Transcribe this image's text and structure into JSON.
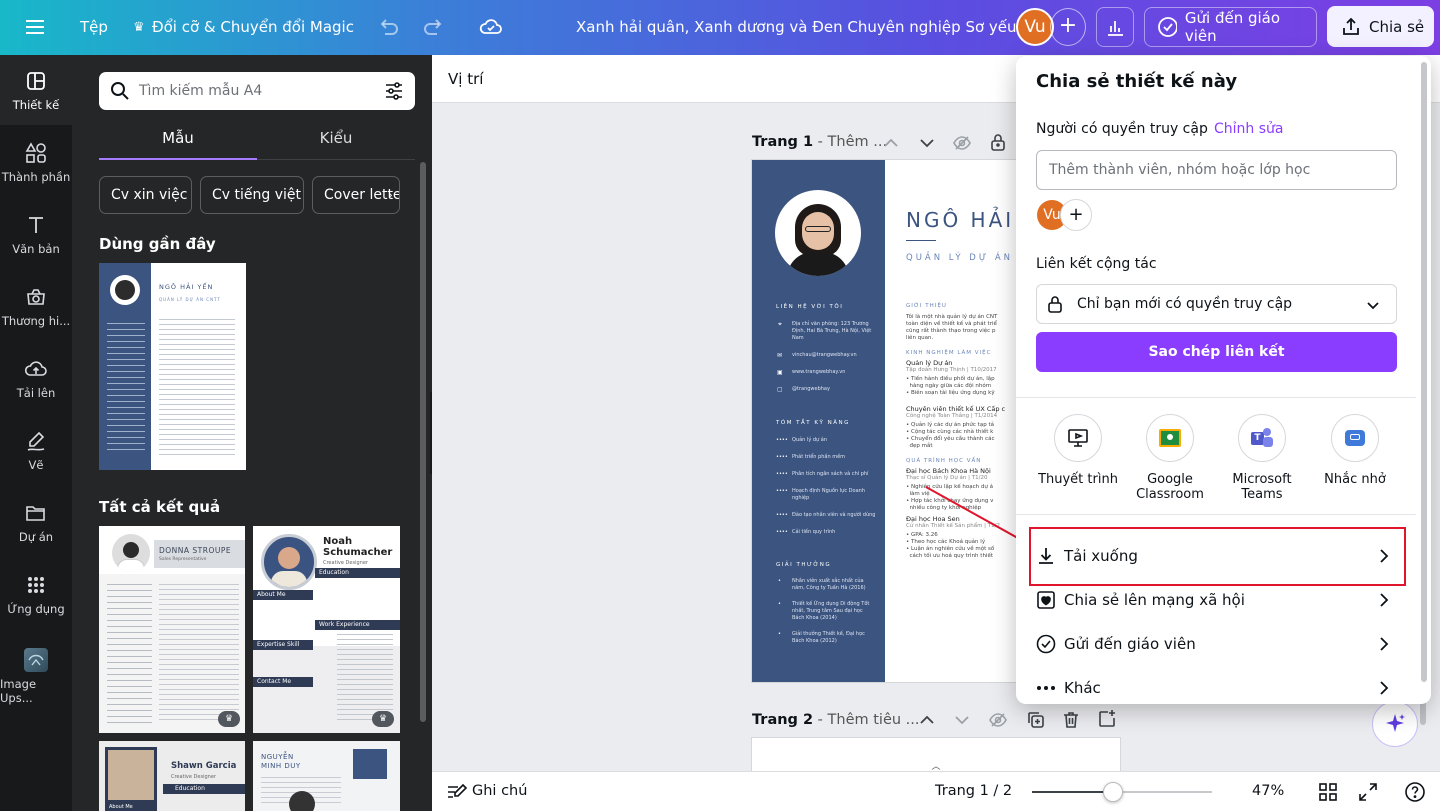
{
  "topbar": {
    "file": "Tệp",
    "magic": "Đổi cỡ & Chuyển đổi Magic",
    "doc_title": "Xanh hải quân, Xanh dương và Đen Chuyên nghiệp Sơ yếu ...",
    "avatar": "Vu",
    "send_teacher": "Gửi đến giáo viên",
    "share": "Chia sẻ"
  },
  "rail": [
    {
      "label": "Thiết kế",
      "icon": "layout-icon"
    },
    {
      "label": "Thành phần",
      "icon": "elements-icon"
    },
    {
      "label": "Văn bản",
      "icon": "text-icon"
    },
    {
      "label": "Thương hi...",
      "icon": "brand-icon"
    },
    {
      "label": "Tải lên",
      "icon": "upload-icon"
    },
    {
      "label": "Vẽ",
      "icon": "draw-icon"
    },
    {
      "label": "Dự án",
      "icon": "folder-icon"
    },
    {
      "label": "Ứng dụng",
      "icon": "apps-icon"
    },
    {
      "label": "Image Ups...",
      "icon": "image-upscaler-icon"
    }
  ],
  "panel": {
    "search_placeholder": "Tìm kiếm mẫu A4",
    "tabs": [
      "Mẫu",
      "Kiểu"
    ],
    "chips": [
      "Cv xin việc",
      "Cv tiếng việt",
      "Cover letter"
    ],
    "recent_title": "Dùng gần đây",
    "results_title": "Tất cả kết quả",
    "recent_name": "NGÔ HẢI YẾN",
    "recent_role": "QUẢN LÝ DỰ ÁN CNTT",
    "templates": [
      {
        "name": "DONNA STROUPE",
        "role": "Sales Representative"
      },
      {
        "name": "Noah Schumacher",
        "role": "Creative Designer"
      },
      {
        "name": "Shawn Garcia",
        "role": "Creative Designer"
      },
      {
        "name": "NGUYỄN MINH DUY",
        "role": ""
      }
    ],
    "tpl_labels": {
      "about": "About Me",
      "education": "Education",
      "work": "Work Experience",
      "expertise": "Expertise Skill",
      "contact": "Contact Me"
    }
  },
  "canvas": {
    "position_label": "Vị trí",
    "page1_label": "Trang 1",
    "page1_title": "Thêm ...",
    "page2_label": "Trang 2",
    "page2_title": "Thêm tiêu ..."
  },
  "resume": {
    "name": "NGÔ HẢI Y",
    "role": "QUẢN LÝ DỰ ÁN",
    "contact_title": "LIÊN HỆ VỚI TÔI",
    "contact_lines": [
      "Địa chỉ văn phòng: 123 Trương Định, Hai Bà Trưng, Hà Nội, Việt Nam",
      "vinchau@trangwebhay.vn",
      "www.trangwebhay.vn",
      "@trangwebhay"
    ],
    "skills_title": "TÓM TẮT KỸ NĂNG",
    "skills": [
      "Quản lý dự án",
      "Phát triển phần mềm",
      "Phân tích ngân sách và chi phí",
      "Hoạch định Nguồn lực Doanh nghiệp",
      "Đào tạo nhân viên và người dùng",
      "Cải tiến quy trình"
    ],
    "awards_title": "GIẢI THƯỞNG",
    "awards": [
      "Nhân viên xuất sắc nhất của năm, Công ty Tuấn Hà (2016)",
      "Thiết kế Ứng dụng Di động Tốt nhất, Trung tâm Sau đại học Bách Khoa (2014)",
      "Giải thưởng Thiết kế, Đại học Bách Khoa (2012)"
    ],
    "intro_title": "GIỚI THIỆU",
    "intro": [
      "Tôi là một nhà quản lý dự án CNT",
      "toàn diện về thiết kế và phát triể",
      "cũng rất thành thạo trong việc p",
      "liên quan."
    ],
    "exp_title": "KINH NGHIỆM LÀM VIỆC",
    "job1_title": "Quản lý Dự án",
    "job1_sub": "Tập đoàn Hưng Thịnh | T10/2017",
    "job1_lines": [
      "Tiến hành điều phối dự án, lập",
      "hàng ngày giữa các đội nhóm",
      "Biên soạn tài liệu ứng dụng kỹ"
    ],
    "job2_title": "Chuyên viên thiết kế UX Cấp c",
    "job2_sub": "Công nghệ Toàn Thắng | T1/2014",
    "job2_lines": [
      "Quản lý các dự án phức tạp tả",
      "Cộng tác cùng các nhà thiết k",
      "Chuyển đổi yêu cầu thành các",
      "đẹp mắt"
    ],
    "edu_title": "QUÁ TRÌNH HỌC VẤN",
    "edu1_title": "Đại học Bách Khoa Hà Nội",
    "edu1_sub": "Thạc sĩ Quản lý Dự án | T1/20",
    "edu1_lines": [
      "Nghiên cứu lập kế hoạch dự á",
      "làm việ",
      "Hợp tác khởi chạy ứng dụng v",
      "nhiều công ty khởi nghiệp"
    ],
    "edu2_title": "Đại học Hoa Sen",
    "edu2_sub": "Cử nhân Thiết kế Sản phẩm | T1/2",
    "edu2_lines": [
      "GPA: 3.26",
      "Theo học các Khoá quản lý",
      "Luận án nghiên cứu về một số",
      "cách tối ưu hoá quy trình thiết"
    ]
  },
  "share_panel": {
    "title": "Chia sẻ thiết kế này",
    "access_label": "Người có quyền truy cập",
    "edit_link": "Chỉnh sửa",
    "invite_placeholder": "Thêm thành viên, nhóm hoặc lớp học",
    "avatar": "Vu",
    "collab_label": "Liên kết cộng tác",
    "access_value": "Chỉ bạn mới có quyền truy cập",
    "copy_link": "Sao chép liên kết",
    "apps": [
      {
        "label": "Thuyết trình",
        "icon": "present-icon"
      },
      {
        "label": "Google Classroom",
        "icon": "google-classroom-icon"
      },
      {
        "label": "Microsoft Teams",
        "icon": "microsoft-teams-icon"
      },
      {
        "label": "Nhắc nhở",
        "icon": "reminder-icon"
      }
    ],
    "actions": [
      {
        "label": "Tải xuống",
        "icon": "download-icon"
      },
      {
        "label": "Chia sẻ lên mạng xã hội",
        "icon": "social-heart-icon"
      },
      {
        "label": "Gửi đến giáo viên",
        "icon": "check-circle-icon"
      },
      {
        "label": "Khác",
        "icon": "more-icon"
      }
    ]
  },
  "bottombar": {
    "notes": "Ghi chú",
    "page_counter": "Trang 1 / 2",
    "zoom": "47%",
    "zoom_level": 0.47
  },
  "colors": {
    "accent": "#8b3dff",
    "highlight_box": "#e0152c",
    "resume_sidebar": "#3c5480",
    "arrow": "#e0152c"
  }
}
